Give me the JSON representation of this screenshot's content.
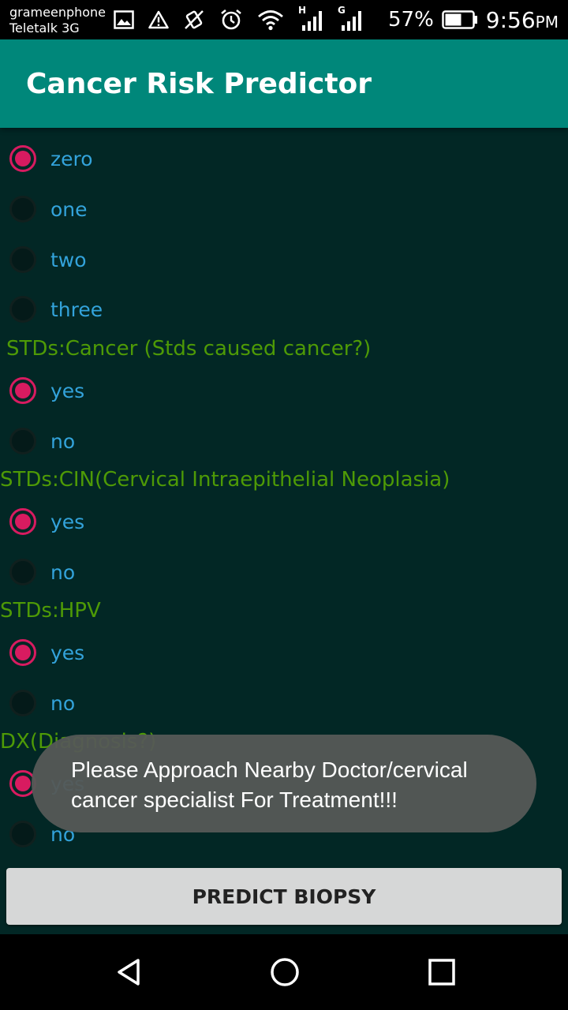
{
  "status_bar": {
    "carrier_1": "grameenphone",
    "carrier_2": "Teletalk 3G",
    "network_1": "H",
    "network_2": "G",
    "battery": "57%",
    "time": "9:56",
    "time_suffix": "PM"
  },
  "app_bar": {
    "title": "Cancer Risk Predictor"
  },
  "questions": [
    {
      "label": "",
      "options": [
        {
          "label": "zero",
          "checked": true
        },
        {
          "label": "one",
          "checked": false
        },
        {
          "label": "two",
          "checked": false
        },
        {
          "label": "three",
          "checked": false
        }
      ]
    },
    {
      "label": "STDs:Cancer (Stds caused cancer?)",
      "options": [
        {
          "label": "yes",
          "checked": true
        },
        {
          "label": "no",
          "checked": false
        }
      ]
    },
    {
      "label": "STDs:CIN(Cervical Intraepithelial Neoplasia)",
      "options": [
        {
          "label": "yes",
          "checked": true
        },
        {
          "label": "no",
          "checked": false
        }
      ]
    },
    {
      "label": "STDs:HPV",
      "options": [
        {
          "label": "yes",
          "checked": true
        },
        {
          "label": "no",
          "checked": false
        }
      ]
    },
    {
      "label": "DX(Diagnosis?)",
      "options": [
        {
          "label": "yes",
          "checked": true
        },
        {
          "label": "no",
          "checked": false
        }
      ]
    }
  ],
  "toast": {
    "message": "Please Approach Nearby Doctor/cervical cancer specialist For Treatment!!!"
  },
  "predict_button": {
    "label": "PREDICT BIOPSY"
  },
  "colors": {
    "app_bar": "#00877A",
    "background": "#022725",
    "question_text": "#4E9A06",
    "option_text": "#33A3DB",
    "radio_checked": "#D81B60"
  }
}
